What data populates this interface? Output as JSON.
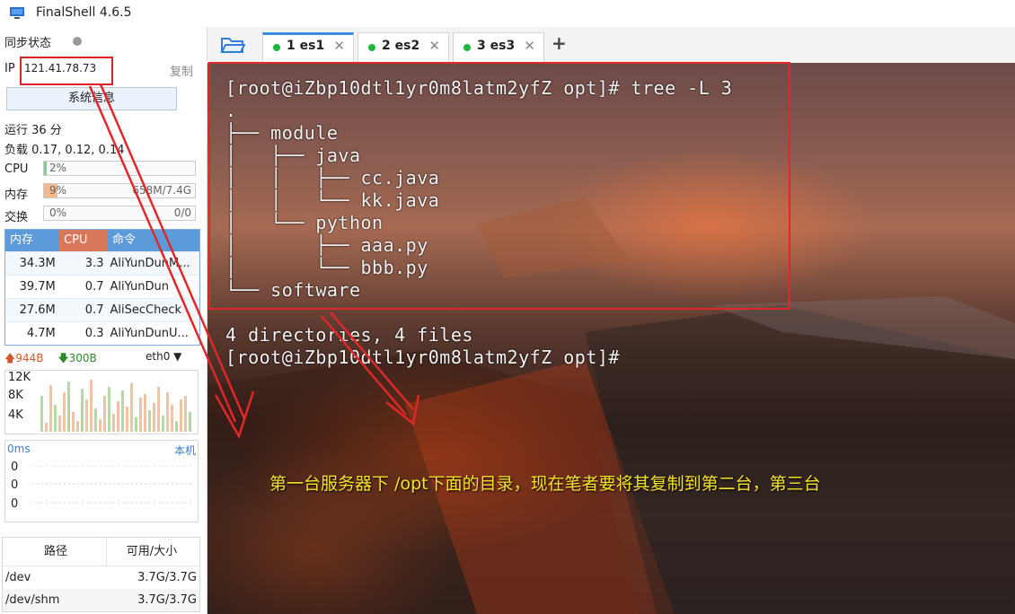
{
  "app": {
    "title": "FinalShell 4.6.5"
  },
  "sidebar": {
    "sync_label": "同步状态",
    "ip_label": "IP",
    "ip_value": "121.41.78.73",
    "copy_label": "复制",
    "sysinfo_button": "系统信息",
    "uptime": "运行 36 分",
    "load": "负载 0.17, 0.12, 0.14",
    "cpu": {
      "label": "CPU",
      "percent_text": "2%",
      "level": 0.02
    },
    "mem": {
      "label": "内存",
      "percent_text": "9%",
      "usage": "658M/7.4G",
      "level": 0.09
    },
    "swap": {
      "label": "交换",
      "percent_text": "0%",
      "usage": "0/0",
      "level": 0
    },
    "proc_headers": [
      "内存",
      "CPU",
      "命令"
    ],
    "processes": [
      {
        "mem": "34.3M",
        "cpu": "3.3",
        "cmd": "AliYunDunM..."
      },
      {
        "mem": "39.7M",
        "cpu": "0.7",
        "cmd": "AliYunDun"
      },
      {
        "mem": "27.6M",
        "cpu": "0.7",
        "cmd": "AliSecCheck"
      },
      {
        "mem": "4.7M",
        "cpu": "0.3",
        "cmd": "AliYunDunU..."
      }
    ],
    "net": {
      "up": "944B",
      "down": "300B",
      "iface": "eth0",
      "y_ticks": [
        "12K",
        "8K",
        "4K"
      ]
    },
    "ping": {
      "label": "0ms",
      "host": "本机",
      "values": [
        "0",
        "0",
        "0"
      ]
    },
    "disk_headers": [
      "路径",
      "可用/大小"
    ],
    "disks": [
      {
        "path": "/dev",
        "size": "3.7G/3.7G"
      },
      {
        "path": "/dev/shm",
        "size": "3.7G/3.7G"
      }
    ]
  },
  "tabs": [
    {
      "label": "1 es1",
      "active": true
    },
    {
      "label": "2 es2",
      "active": false
    },
    {
      "label": "3 es3",
      "active": false
    }
  ],
  "terminal": {
    "lines": [
      "[root@iZbp10dtl1yr0m8latm2yfZ opt]# tree -L 3",
      ".",
      "├── module",
      "│   ├── java",
      "│   │   ├── cc.java",
      "│   │   └── kk.java",
      "│   └── python",
      "│       ├── aaa.py",
      "│       └── bbb.py",
      "└── software",
      "",
      "4 directories, 4 files",
      "[root@iZbp10dtl1yr0m8latm2yfZ opt]#"
    ],
    "annotation": "第一台服务器下 /opt下面的目录，现在笔者要将其复制到第二台，第三台"
  },
  "colors": {
    "accent": "#3b8fe0",
    "annotation": "#f3e12a",
    "highlight_box": "#e02828",
    "proc_header": "#5b9bd9"
  }
}
